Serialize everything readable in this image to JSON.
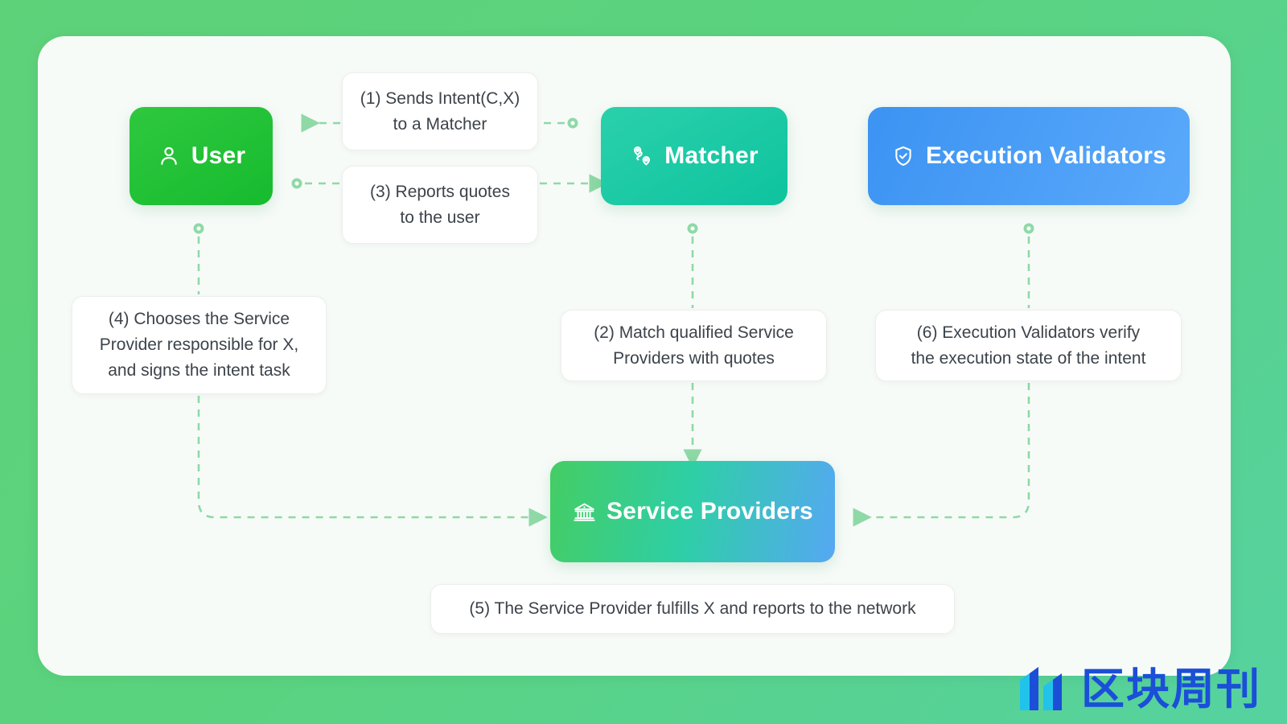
{
  "diagram": {
    "nodes": [
      {
        "id": "user",
        "label": "User",
        "icon": "user-icon",
        "color": "#16bb2e"
      },
      {
        "id": "matcher",
        "label": "Matcher",
        "icon": "route-pins-icon",
        "color": "#0ec39f"
      },
      {
        "id": "validators",
        "label": "Execution Validators",
        "icon": "shield-check-icon",
        "color": "#3c93f2"
      },
      {
        "id": "providers",
        "label": "Service Providers",
        "icon": "bank-icon",
        "color": "#2ecfa6"
      }
    ],
    "steps": [
      {
        "id": "step-1",
        "number": "(1)",
        "text": "(1) Sends Intent(C,X)\nto a Matcher"
      },
      {
        "id": "step-2",
        "number": "(2)",
        "text": "(2) Match qualified Service\nProviders with quotes"
      },
      {
        "id": "step-3",
        "number": "(3)",
        "text": "(3) Reports quotes\nto the user"
      },
      {
        "id": "step-4",
        "number": "(4)",
        "text": "(4) Chooses the Service\nProvider responsible for X,\nand signs the intent task"
      },
      {
        "id": "step-5",
        "number": "(5)",
        "text": "(5) The Service Provider fulfills X and reports to the network"
      },
      {
        "id": "step-6",
        "number": "(6)",
        "text": "(6) Execution Validators verify\nthe execution state of the intent"
      }
    ],
    "connectors": [
      {
        "from": "matcher",
        "to": "user",
        "label_ref": "step-1",
        "style": "dashed",
        "arrow": "left"
      },
      {
        "from": "user",
        "to": "matcher",
        "label_ref": "step-3",
        "style": "dashed",
        "arrow": "right"
      },
      {
        "from": "matcher",
        "to": "providers",
        "label_ref": "step-2",
        "style": "dashed",
        "arrow": "down"
      },
      {
        "from": "user",
        "to": "providers",
        "label_ref": "step-4",
        "style": "dashed",
        "arrow": "right"
      },
      {
        "from": "validators",
        "to": "providers",
        "label_ref": "step-6",
        "style": "dashed",
        "arrow": "left"
      }
    ],
    "line_color": "#8fd9a7"
  },
  "watermark": {
    "text": "区块周刊",
    "logo": "bars-logo-icon",
    "color": "#1b4fd8"
  }
}
